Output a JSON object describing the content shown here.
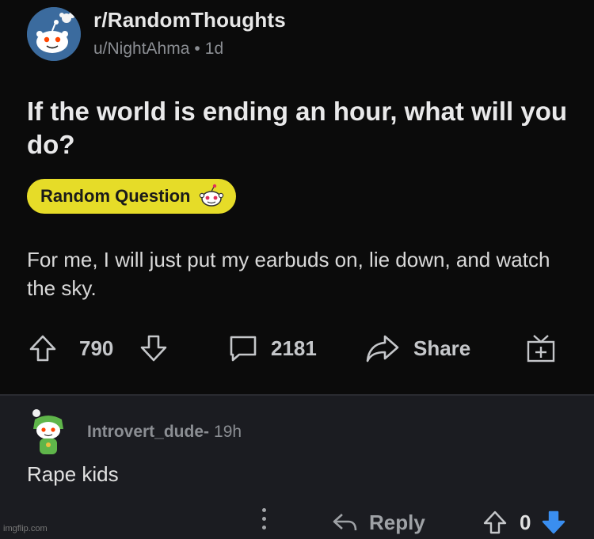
{
  "post": {
    "subreddit": "r/RandomThoughts",
    "author": "u/NightAhma",
    "age": "1d",
    "title": "If the world is ending an hour, what will you do?",
    "flair": "Random Question",
    "body": "For me, I will just put my earbuds on, lie down, and watch the sky.",
    "upvotes": "790",
    "comments": "2181",
    "share_label": "Share",
    "icons": [
      "upvote-icon",
      "downvote-icon",
      "comment-icon",
      "share-icon",
      "award-icon"
    ]
  },
  "comment": {
    "username": "Introvert_dude-",
    "age": "19h",
    "text": "Rape kids",
    "reply_label": "Reply",
    "score": "0",
    "downvote_color": "#3a8ef0"
  },
  "watermark": "imgflip.com",
  "colors": {
    "flair_bg": "#e6dc28",
    "post_bg": "#0b0b0b",
    "comment_bg": "#1b1c21"
  }
}
